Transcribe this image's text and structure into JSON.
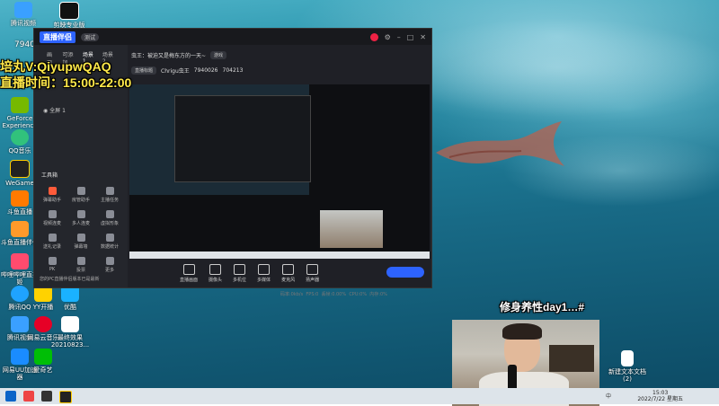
{
  "overlay": {
    "room_number": "7940026",
    "contact_line": "培丸V:QiyupwQAQ",
    "schedule_line": "直播时间：15:00-22:00",
    "caption": "修身养性day1…#"
  },
  "desktop_icons": [
    {
      "label": "腾讯视频"
    },
    {
      "label": "剪映专业版"
    },
    {
      "label": "GeForce Experience"
    },
    {
      "label": "QQ音乐"
    },
    {
      "label": "WeGame"
    },
    {
      "label": "斗鱼直播"
    },
    {
      "label": "斗鱼直播伴侣"
    },
    {
      "label": "哔哩哔哩直播姬"
    },
    {
      "label": "腾讯QQ"
    },
    {
      "label": "YY开播"
    },
    {
      "label": "优酷"
    },
    {
      "label": "腾讯视频"
    },
    {
      "label": "网易云音乐"
    },
    {
      "label": "最终效果 20210823..."
    },
    {
      "label": "网易UU加速器"
    },
    {
      "label": "爱奇艺"
    },
    {
      "label": "新建文本文档 (2)"
    }
  ],
  "app": {
    "logo": "直播伴侣",
    "version_badge": "测试",
    "tabs": [
      "画面",
      "可添加",
      "场景 1",
      "场景 2"
    ],
    "scene_item": "全屏 1",
    "room_title": "虫王：被迫又是梅东方的一天~",
    "category": "游戏",
    "room_prefix": "直播标题",
    "room_owner": "Chrigu虫王",
    "room_id": "7940026",
    "viewer_count": "704213",
    "tools_title": "工具箱",
    "tools": [
      {
        "label": "弹幕助手"
      },
      {
        "label": "房管助手"
      },
      {
        "label": "主播任务"
      },
      {
        "label": "视频连麦"
      },
      {
        "label": "多人连麦"
      },
      {
        "label": "虚拟形象"
      },
      {
        "label": "送礼记录"
      },
      {
        "label": "弹幕墙"
      },
      {
        "label": "数据统计"
      },
      {
        "label": "PK"
      },
      {
        "label": "投票"
      },
      {
        "label": "更多"
      }
    ],
    "notice": "您的PC直播伴侣版本已是最新",
    "bottom_tools": [
      {
        "label": "直播画面"
      },
      {
        "label": "摄像头"
      },
      {
        "label": "多机位"
      },
      {
        "label": "多媒体"
      },
      {
        "label": "麦克风"
      },
      {
        "label": "扬声器"
      }
    ],
    "status": [
      "码率:0kb/s",
      "FPS:0",
      "丢帧:0.00%",
      "CPU:0%",
      "内存:0%"
    ]
  },
  "taskbar": {
    "clock_time": "15:03",
    "clock_date": "2022/7/22 星期五",
    "tray_text": "中"
  }
}
